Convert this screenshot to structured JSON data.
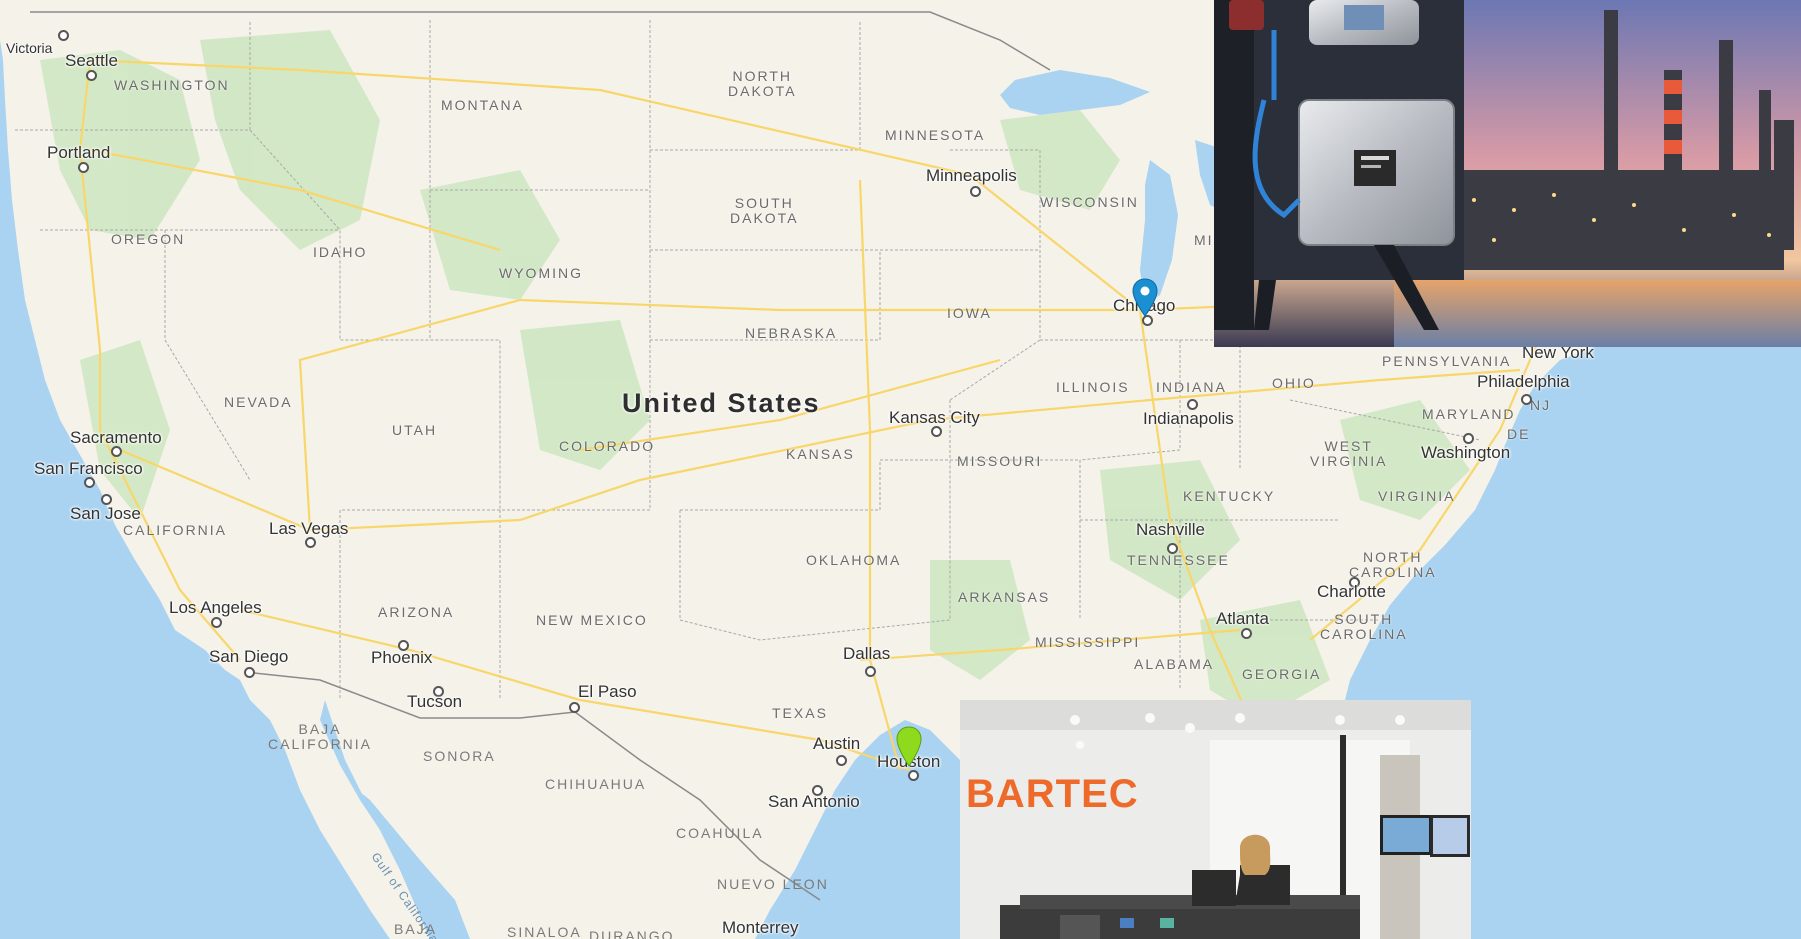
{
  "map": {
    "country_label": "United States",
    "water_labels": {
      "gulf_of_california": "Gulf of California"
    },
    "cities": {
      "victoria": "Victoria",
      "seattle": "Seattle",
      "portland": "Portland",
      "sacramento": "Sacramento",
      "san_francisco": "San Francisco",
      "san_jose": "San Jose",
      "las_vegas": "Las Vegas",
      "los_angeles": "Los Angeles",
      "san_diego": "San Diego",
      "phoenix": "Phoenix",
      "tucson": "Tucson",
      "el_paso": "El Paso",
      "minneapolis": "Minneapolis",
      "chicago": "Chicago",
      "kansas_city": "Kansas City",
      "indianapolis": "Indianapolis",
      "nashville": "Nashville",
      "dallas": "Dallas",
      "austin": "Austin",
      "houston": "Houston",
      "san_antonio": "San Antonio",
      "monterrey": "Monterrey",
      "atlanta": "Atlanta",
      "charlotte": "Charlotte",
      "washington": "Washington",
      "philadelphia": "Philadelphia",
      "new_york": "New York"
    },
    "states": {
      "washington": "WASHINGTON",
      "oregon": "OREGON",
      "idaho": "IDAHO",
      "montana": "MONTANA",
      "wyoming": "WYOMING",
      "nevada": "NEVADA",
      "utah": "UTAH",
      "california": "CALIFORNIA",
      "arizona": "ARIZONA",
      "colorado": "COLORADO",
      "new_mexico": "NEW MEXICO",
      "north_dakota": "NORTH\nDAKOTA",
      "south_dakota": "SOUTH\nDAKOTA",
      "nebraska": "NEBRASKA",
      "kansas": "KANSAS",
      "oklahoma": "OKLAHOMA",
      "texas": "TEXAS",
      "minnesota": "MINNESOTA",
      "iowa": "IOWA",
      "missouri": "MISSOURI",
      "arkansas": "ARKANSAS",
      "wisconsin": "WISCONSIN",
      "michigan": "MI",
      "illinois": "ILLINOIS",
      "indiana": "INDIANA",
      "ohio": "OHIO",
      "kentucky": "KENTUCKY",
      "tennessee": "TENNESSEE",
      "mississippi": "MISSISSIPPI",
      "alabama": "ALABAMA",
      "georgia": "GEORGIA",
      "north_carolina": "NORTH\nCAROLINA",
      "south_carolina": "SOUTH\nCAROLINA",
      "virginia": "VIRGINIA",
      "west_virginia": "WEST\nVIRGINIA",
      "pennsylvania": "PENNSYLVANIA",
      "maryland": "MARYLAND",
      "new_jersey": "NJ",
      "delaware": "DE"
    },
    "mexico_regions": {
      "baja_california": "BAJA\nCALIFORNIA",
      "sonora": "SONORA",
      "chihuahua": "CHIHUAHUA",
      "coahuila": "COAHUILA",
      "nuevo_leon": "NUEVO LEON",
      "baja": "BAJA",
      "sinaloa": "SINALOA",
      "durango": "DURANGO"
    },
    "markers": [
      {
        "name": "chicago-marker",
        "color": "#1a8fd1"
      },
      {
        "name": "houston-marker",
        "color": "#8ddb1c"
      }
    ],
    "colors": {
      "water": "#a9d3f1",
      "land": "#f5f2ea",
      "vegetation": "#cde6c0",
      "highway": "#f8d66a",
      "border": "#9a9a9a"
    }
  },
  "insets": {
    "refinery_photo": {
      "icon": "industrial-analyzer-cabinet-refinery-photo"
    },
    "office_photo": {
      "logo_text": "BARTEC",
      "logo_color": "#ee6a2a",
      "icon": "office-reception-photo"
    }
  }
}
